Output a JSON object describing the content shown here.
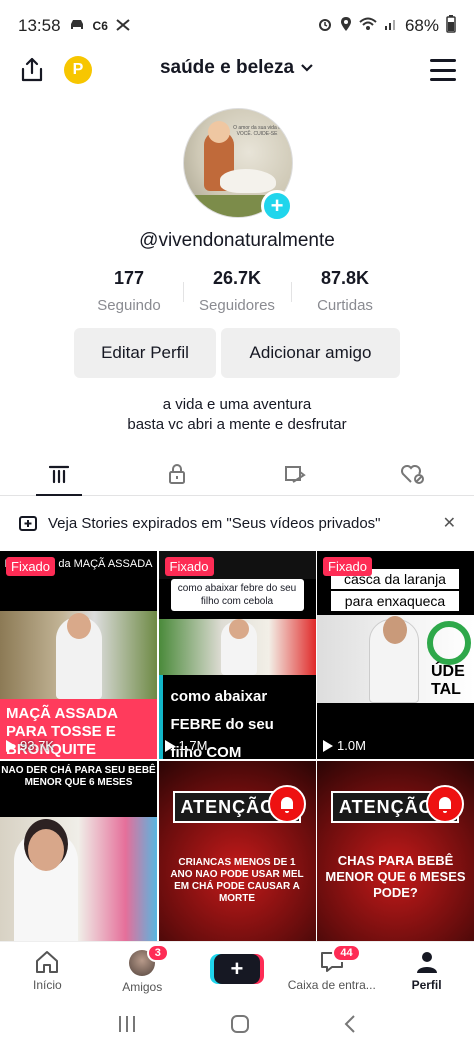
{
  "status_bar": {
    "time": "13:58",
    "left_icons": [
      "car-icon",
      "c6-icon",
      "cast-icon"
    ],
    "c6_label": "C6",
    "battery": "68%"
  },
  "header": {
    "account_name": "saúde e beleza",
    "coin_label": "P"
  },
  "profile": {
    "username": "@vivendonaturalmente",
    "avatar_text": "O amor da sua vida é VOCÊ. CUIDE-SE",
    "stats": [
      {
        "value": "177",
        "label": "Seguindo"
      },
      {
        "value": "26.7K",
        "label": "Seguidores"
      },
      {
        "value": "87.8K",
        "label": "Curtidas"
      }
    ],
    "edit_button": "Editar Perfil",
    "add_friend_button": "Adicionar amigo",
    "bio_line1": "a vida e uma aventura",
    "bio_line2": "basta vc abri a mente e desfrutar"
  },
  "tabs": [
    "videos-grid-icon",
    "private-lock-icon",
    "reposts-icon",
    "liked-icon"
  ],
  "stories_banner": {
    "text": "Veja Stories expirados em \"Seus vídeos privados\""
  },
  "videos": [
    {
      "pinned_label": "Fixado",
      "top_text": "Beneficios da MAÇÃ ASSADA",
      "caption": "MAÇÃ ASSADA PARA TOSSE E BRONQUITE",
      "views": "93.7K"
    },
    {
      "pinned_label": "Fixado",
      "top_text": "como abaixar febre do seu filho com cebola",
      "caption": "como abaixar FEBRE do seu filho COM CEBOLA",
      "views": "1.7M"
    },
    {
      "pinned_label": "Fixado",
      "top_text_line1": "casca da laranja",
      "top_text_line2": "para enxaqueca",
      "logo_text": "ÚDE TAL",
      "views": "1.0M"
    },
    {
      "top_text": "NAO DER CHÁ PARA SEU BEBÊ MENOR QUE 6 MESES"
    },
    {
      "banner": "ATENÇÃO!",
      "caption": "CRIANCAS MENOS DE 1 ANO NAO PODE USAR MEL EM CHÁ PODE CAUSAR A MORTE"
    },
    {
      "banner": "ATENÇÃO!",
      "caption": "CHAS PARA BEBÊ MENOR QUE 6 MESES PODE?"
    }
  ],
  "bottom_nav": [
    {
      "label": "Início",
      "icon": "home-icon"
    },
    {
      "label": "Amigos",
      "icon": "friends-avatar",
      "badge": "3"
    },
    {
      "label": "",
      "icon": "create-plus-icon"
    },
    {
      "label": "Caixa de entra...",
      "icon": "inbox-icon",
      "badge": "44"
    },
    {
      "label": "Perfil",
      "icon": "profile-icon"
    }
  ],
  "colors": {
    "accent_pink": "#fe2c55",
    "accent_cyan": "#20d5ec",
    "text": "#161823",
    "muted": "#8a8b91",
    "button_bg": "#efefef"
  }
}
